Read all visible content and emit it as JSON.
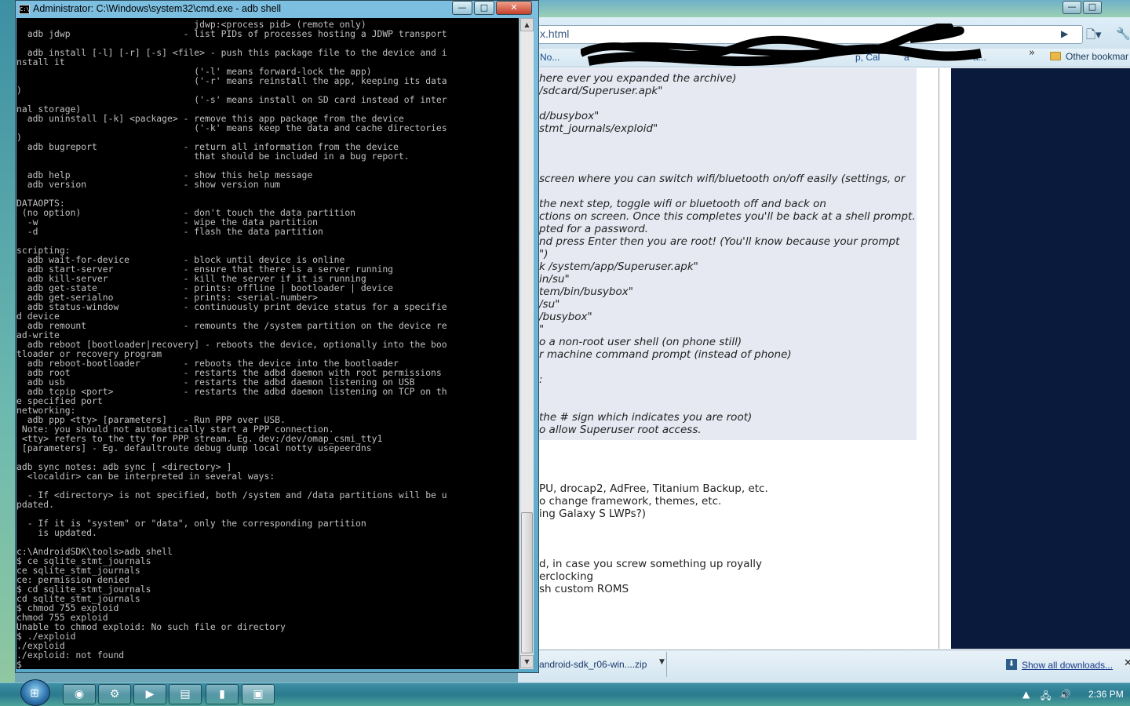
{
  "cmd": {
    "title": "Administrator: C:\\Windows\\system32\\cmd.exe - adb  shell",
    "icon_label": "C:\\",
    "console_text": "                                 jdwp:<process pid> (remote only)\n  adb jdwp                     - list PIDs of processes hosting a JDWP transport\n\n  adb install [-l] [-r] [-s] <file> - push this package file to the device and i\nnstall it\n                                 ('-l' means forward-lock the app)\n                                 ('-r' means reinstall the app, keeping its data\n)\n                                 ('-s' means install on SD card instead of inter\nnal storage)\n  adb uninstall [-k] <package> - remove this app package from the device\n                                 ('-k' means keep the data and cache directories\n)\n  adb bugreport                - return all information from the device\n                                 that should be included in a bug report.\n\n  adb help                     - show this help message\n  adb version                  - show version num\n\nDATAOPTS:\n (no option)                   - don't touch the data partition\n  -w                           - wipe the data partition\n  -d                           - flash the data partition\n\nscripting:\n  adb wait-for-device          - block until device is online\n  adb start-server             - ensure that there is a server running\n  adb kill-server              - kill the server if it is running\n  adb get-state                - prints: offline | bootloader | device\n  adb get-serialno             - prints: <serial-number>\n  adb status-window            - continuously print device status for a specifie\nd device\n  adb remount                  - remounts the /system partition on the device re\nad-write\n  adb reboot [bootloader|recovery] - reboots the device, optionally into the boo\ntloader or recovery program\n  adb reboot-bootloader        - reboots the device into the bootloader\n  adb root                     - restarts the adbd daemon with root permissions\n  adb usb                      - restarts the adbd daemon listening on USB\n  adb tcpip <port>             - restarts the adbd daemon listening on TCP on th\ne specified port\nnetworking:\n  adb ppp <tty> [parameters]   - Run PPP over USB.\n Note: you should not automatically start a PPP connection.\n <tty> refers to the tty for PPP stream. Eg. dev:/dev/omap_csmi_tty1\n [parameters] - Eg. defaultroute debug dump local notty usepeerdns\n\nadb sync notes: adb sync [ <directory> ]\n  <localdir> can be interpreted in several ways:\n\n  - If <directory> is not specified, both /system and /data partitions will be u\npdated.\n\n  - If it is \"system\" or \"data\", only the corresponding partition\n    is updated.\n\nc:\\AndroidSDK\\tools>adb shell\n$ ce sqlite_stmt_journals\nce sqlite_stmt_journals\nce: permission denied\n$ cd sqlite_stmt_journals\ncd sqlite_stmt_journals\n$ chmod 755 exploid\nchmod 755 exploid\nUnable to chmod exploid: No such file or directory\n$ ./exploid\n./exploid\n./exploid: not found\n$",
    "controls": {
      "minimize": "—",
      "maximize": "□",
      "close": "✕"
    }
  },
  "browser": {
    "address": "x.html",
    "controls": {
      "minimize": "—",
      "maximize": "□"
    },
    "bookmarks": [
      "No...",
      "p, Cal",
      "a",
      "a..."
    ],
    "bookmark_overflow": "»",
    "other_bookmarks": "Other bookmar",
    "page_lines": [
      {
        "text": "here ever you expanded the archive)",
        "italic": true
      },
      {
        "text": "/sdcard/Superuser.apk\"",
        "italic": true
      },
      {
        "text": "d/busybox\"",
        "italic": true
      },
      {
        "text": "stmt_journals/exploid\"",
        "italic": true
      },
      {
        "text": "screen where you can switch wifi/bluetooth on/off easily (settings, or",
        "italic": true
      },
      {
        "text": "the next step, toggle wifi or bluetooth off and back on",
        "italic": true
      },
      {
        "text": "ctions on screen. Once this completes you'll be back at a shell prompt.",
        "italic": true
      },
      {
        "text": "pted for a password.",
        "italic": true
      },
      {
        "text": "nd press Enter then you are root! (You'll know because your prompt",
        "italic": true
      },
      {
        "text": "\")",
        "italic": true
      },
      {
        "text": "k /system/app/Superuser.apk\"",
        "italic": true
      },
      {
        "text": "in/su\"",
        "italic": true
      },
      {
        "text": "tem/bin/busybox\"",
        "italic": true
      },
      {
        "text": "/su\"",
        "italic": true
      },
      {
        "text": "/busybox\"",
        "italic": true
      },
      {
        "text": "\"",
        "italic": true
      },
      {
        "text": "o a non-root user shell (on phone still)",
        "italic": true
      },
      {
        "text": "r machine command prompt (instead of phone)",
        "italic": true
      },
      {
        "text": ":",
        "italic": true
      },
      {
        "text": "the # sign which indicates you are root)",
        "italic": true
      },
      {
        "text": "o allow Superuser root access.",
        "italic": true
      },
      {
        "text": "PU, drocap2, AdFree, Titanium Backup, etc.",
        "italic": false
      },
      {
        "text": "o change framework, themes, etc.",
        "italic": false
      },
      {
        "text": "ing Galaxy S LWPs?)",
        "italic": false
      },
      {
        "text": "d, in case you screw something up royally",
        "italic": false
      },
      {
        "text": "erclocking",
        "italic": false
      },
      {
        "text": "sh custom ROMS",
        "italic": false
      }
    ],
    "download": {
      "file": "android-sdk_r06-win....zip",
      "show_all": "Show all downloads...",
      "close": "✕"
    }
  },
  "taskbar": {
    "clock": "2:36 PM",
    "buttons": [
      "chrome-icon",
      "network-icon",
      "media-player-icon",
      "explorer-icon",
      "phone-icon",
      "cmd-icon"
    ]
  },
  "colors": {
    "console_bg": "#000000",
    "console_fg": "#c0c0c0",
    "code_box": "#e6e9f2",
    "sidebar": "#0a1a3c"
  }
}
